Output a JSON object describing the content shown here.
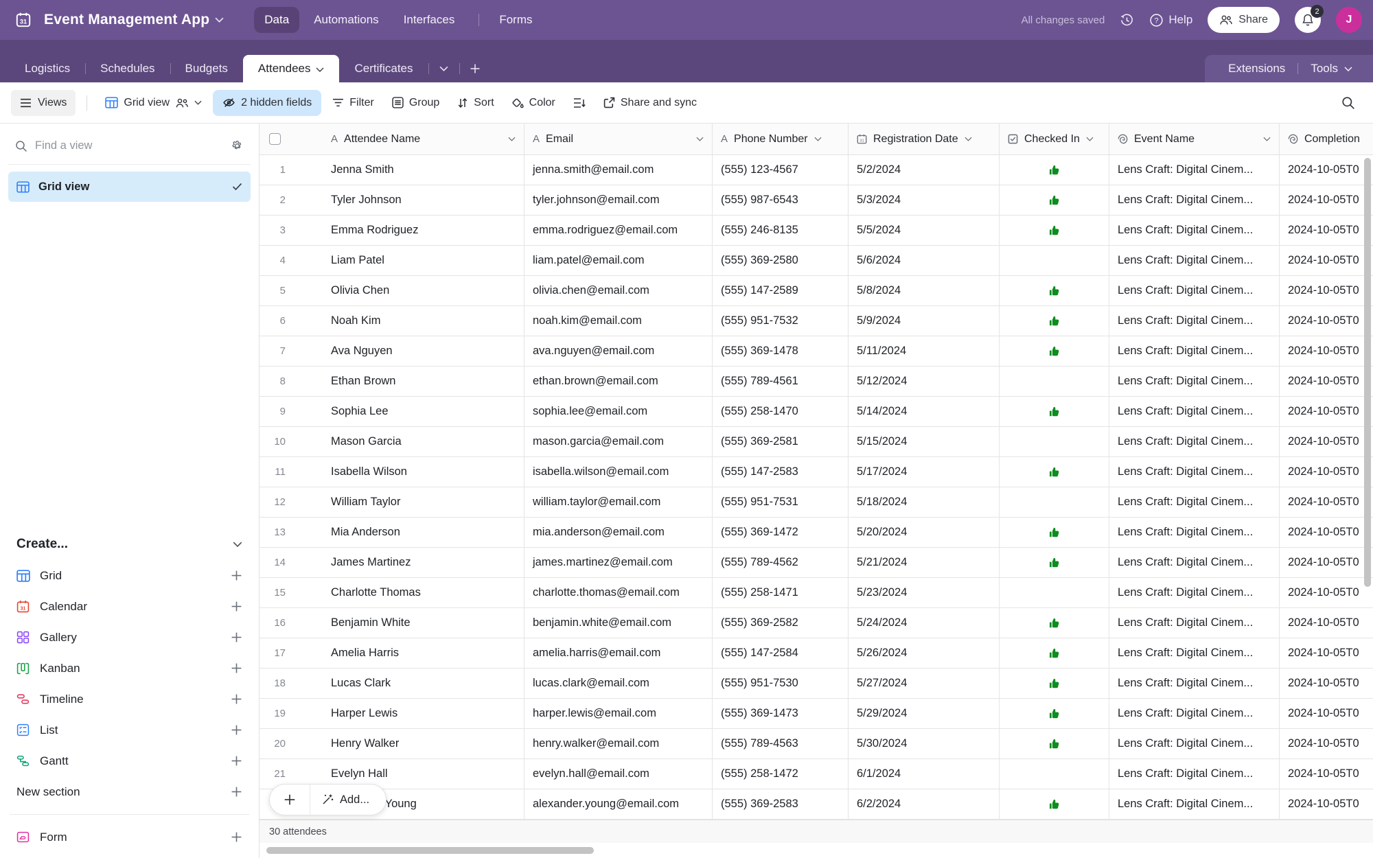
{
  "colors": {
    "topbar_purple": "#6C5492",
    "tabstrip_purple": "#5B477B",
    "accent_blue": "#2d7ff9",
    "selected_view_blue": "#d7ecfb",
    "hidden_fields_blue": "#cfe7fd",
    "checked_green": "#0d8c1f",
    "avatar_pink": "#cb2f9c"
  },
  "topbar": {
    "app_title": "Event Management App",
    "nav": [
      {
        "label": "Data",
        "active": true
      },
      {
        "label": "Automations"
      },
      {
        "label": "Interfaces"
      },
      {
        "label": "Forms",
        "sep_before": true
      }
    ],
    "status": "All changes saved",
    "help_label": "Help",
    "share_label": "Share",
    "notification_count": "2",
    "avatar_initial": "J"
  },
  "tabbar": {
    "tabs": [
      {
        "label": "Logistics"
      },
      {
        "label": "Schedules"
      },
      {
        "label": "Budgets"
      },
      {
        "label": "Attendees",
        "active": true
      },
      {
        "label": "Certificates"
      }
    ],
    "extensions_label": "Extensions",
    "tools_label": "Tools"
  },
  "toolbar": {
    "views_label": "Views",
    "view_name": "Grid view",
    "hidden_fields_label": "2 hidden fields",
    "filter_label": "Filter",
    "group_label": "Group",
    "sort_label": "Sort",
    "color_label": "Color",
    "share_sync_label": "Share and sync"
  },
  "sidebar": {
    "search_placeholder": "Find a view",
    "views": [
      {
        "label": "Grid view",
        "icon": "grid-icon",
        "color": "#2d7ff9",
        "selected": true
      }
    ],
    "create_label": "Create...",
    "create_items": [
      {
        "label": "Grid",
        "icon": "grid-icon",
        "color": "#2d7ff9"
      },
      {
        "label": "Calendar",
        "icon": "calendar-icon",
        "color": "#e8432e"
      },
      {
        "label": "Gallery",
        "icon": "gallery-icon",
        "color": "#8b46ff"
      },
      {
        "label": "Kanban",
        "icon": "kanban-icon",
        "color": "#1aa34a"
      },
      {
        "label": "Timeline",
        "icon": "timeline-icon",
        "color": "#e5395f"
      },
      {
        "label": "List",
        "icon": "list-icon",
        "color": "#2d7ff9"
      },
      {
        "label": "Gantt",
        "icon": "gantt-icon",
        "color": "#14a378"
      },
      {
        "label": "New section"
      }
    ],
    "form_items": [
      {
        "label": "Form",
        "icon": "form-icon",
        "color": "#e231a3"
      }
    ]
  },
  "table": {
    "columns": [
      {
        "label": "Attendee Name",
        "icon": "a-icon",
        "chevron": true
      },
      {
        "label": "Email",
        "icon": "a-icon",
        "chevron": true
      },
      {
        "label": "Phone Number",
        "icon": "a-icon",
        "chevron": true
      },
      {
        "label": "Registration Date",
        "icon": "calendar-icon",
        "chevron": true
      },
      {
        "label": "Checked In",
        "icon": "checkbox-icon",
        "chevron": true
      },
      {
        "label": "Event Name",
        "icon": "spiral-icon",
        "chevron": true
      },
      {
        "label": "Completion",
        "icon": "spiral-icon",
        "chevron": false
      }
    ],
    "rows": [
      {
        "num": "1",
        "name": "Jenna Smith",
        "email": "jenna.smith@email.com",
        "phone": "(555) 123-4567",
        "date": "5/2/2024",
        "checked": true,
        "event": "Lens Craft: Digital Cinem...",
        "completion": "2024-10-05T0"
      },
      {
        "num": "2",
        "name": "Tyler Johnson",
        "email": "tyler.johnson@email.com",
        "phone": "(555) 987-6543",
        "date": "5/3/2024",
        "checked": true,
        "event": "Lens Craft: Digital Cinem...",
        "completion": "2024-10-05T0"
      },
      {
        "num": "3",
        "name": "Emma Rodriguez",
        "email": "emma.rodriguez@email.com",
        "phone": "(555) 246-8135",
        "date": "5/5/2024",
        "checked": true,
        "event": "Lens Craft: Digital Cinem...",
        "completion": "2024-10-05T0"
      },
      {
        "num": "4",
        "name": "Liam Patel",
        "email": "liam.patel@email.com",
        "phone": "(555) 369-2580",
        "date": "5/6/2024",
        "checked": false,
        "event": "Lens Craft: Digital Cinem...",
        "completion": "2024-10-05T0"
      },
      {
        "num": "5",
        "name": "Olivia Chen",
        "email": "olivia.chen@email.com",
        "phone": "(555) 147-2589",
        "date": "5/8/2024",
        "checked": true,
        "event": "Lens Craft: Digital Cinem...",
        "completion": "2024-10-05T0"
      },
      {
        "num": "6",
        "name": "Noah Kim",
        "email": "noah.kim@email.com",
        "phone": "(555) 951-7532",
        "date": "5/9/2024",
        "checked": true,
        "event": "Lens Craft: Digital Cinem...",
        "completion": "2024-10-05T0"
      },
      {
        "num": "7",
        "name": "Ava Nguyen",
        "email": "ava.nguyen@email.com",
        "phone": "(555) 369-1478",
        "date": "5/11/2024",
        "checked": true,
        "event": "Lens Craft: Digital Cinem...",
        "completion": "2024-10-05T0"
      },
      {
        "num": "8",
        "name": "Ethan Brown",
        "email": "ethan.brown@email.com",
        "phone": "(555) 789-4561",
        "date": "5/12/2024",
        "checked": false,
        "event": "Lens Craft: Digital Cinem...",
        "completion": "2024-10-05T0"
      },
      {
        "num": "9",
        "name": "Sophia Lee",
        "email": "sophia.lee@email.com",
        "phone": "(555) 258-1470",
        "date": "5/14/2024",
        "checked": true,
        "event": "Lens Craft: Digital Cinem...",
        "completion": "2024-10-05T0"
      },
      {
        "num": "10",
        "name": "Mason Garcia",
        "email": "mason.garcia@email.com",
        "phone": "(555) 369-2581",
        "date": "5/15/2024",
        "checked": false,
        "event": "Lens Craft: Digital Cinem...",
        "completion": "2024-10-05T0"
      },
      {
        "num": "11",
        "name": "Isabella Wilson",
        "email": "isabella.wilson@email.com",
        "phone": "(555) 147-2583",
        "date": "5/17/2024",
        "checked": true,
        "event": "Lens Craft: Digital Cinem...",
        "completion": "2024-10-05T0"
      },
      {
        "num": "12",
        "name": "William Taylor",
        "email": "william.taylor@email.com",
        "phone": "(555) 951-7531",
        "date": "5/18/2024",
        "checked": false,
        "event": "Lens Craft: Digital Cinem...",
        "completion": "2024-10-05T0"
      },
      {
        "num": "13",
        "name": "Mia Anderson",
        "email": "mia.anderson@email.com",
        "phone": "(555) 369-1472",
        "date": "5/20/2024",
        "checked": true,
        "event": "Lens Craft: Digital Cinem...",
        "completion": "2024-10-05T0"
      },
      {
        "num": "14",
        "name": "James Martinez",
        "email": "james.martinez@email.com",
        "phone": "(555) 789-4562",
        "date": "5/21/2024",
        "checked": true,
        "event": "Lens Craft: Digital Cinem...",
        "completion": "2024-10-05T0"
      },
      {
        "num": "15",
        "name": "Charlotte Thomas",
        "email": "charlotte.thomas@email.com",
        "phone": "(555) 258-1471",
        "date": "5/23/2024",
        "checked": false,
        "event": "Lens Craft: Digital Cinem...",
        "completion": "2024-10-05T0"
      },
      {
        "num": "16",
        "name": "Benjamin White",
        "email": "benjamin.white@email.com",
        "phone": "(555) 369-2582",
        "date": "5/24/2024",
        "checked": true,
        "event": "Lens Craft: Digital Cinem...",
        "completion": "2024-10-05T0"
      },
      {
        "num": "17",
        "name": "Amelia Harris",
        "email": "amelia.harris@email.com",
        "phone": "(555) 147-2584",
        "date": "5/26/2024",
        "checked": true,
        "event": "Lens Craft: Digital Cinem...",
        "completion": "2024-10-05T0"
      },
      {
        "num": "18",
        "name": "Lucas Clark",
        "email": "lucas.clark@email.com",
        "phone": "(555) 951-7530",
        "date": "5/27/2024",
        "checked": true,
        "event": "Lens Craft: Digital Cinem...",
        "completion": "2024-10-05T0"
      },
      {
        "num": "19",
        "name": "Harper Lewis",
        "email": "harper.lewis@email.com",
        "phone": "(555) 369-1473",
        "date": "5/29/2024",
        "checked": true,
        "event": "Lens Craft: Digital Cinem...",
        "completion": "2024-10-05T0"
      },
      {
        "num": "20",
        "name": "Henry Walker",
        "email": "henry.walker@email.com",
        "phone": "(555) 789-4563",
        "date": "5/30/2024",
        "checked": true,
        "event": "Lens Craft: Digital Cinem...",
        "completion": "2024-10-05T0"
      },
      {
        "num": "21",
        "name": "Evelyn Hall",
        "email": "evelyn.hall@email.com",
        "phone": "(555) 258-1472",
        "date": "6/1/2024",
        "checked": false,
        "event": "Lens Craft: Digital Cinem...",
        "completion": "2024-10-05T0"
      },
      {
        "num": "22",
        "name": "Alexander Young",
        "email": "alexander.young@email.com",
        "phone": "(555) 369-2583",
        "date": "6/2/2024",
        "checked": true,
        "event": "Lens Craft: Digital Cinem...",
        "completion": "2024-10-05T0"
      }
    ],
    "row_count_label": "30 attendees",
    "add_button_label": "Add..."
  }
}
